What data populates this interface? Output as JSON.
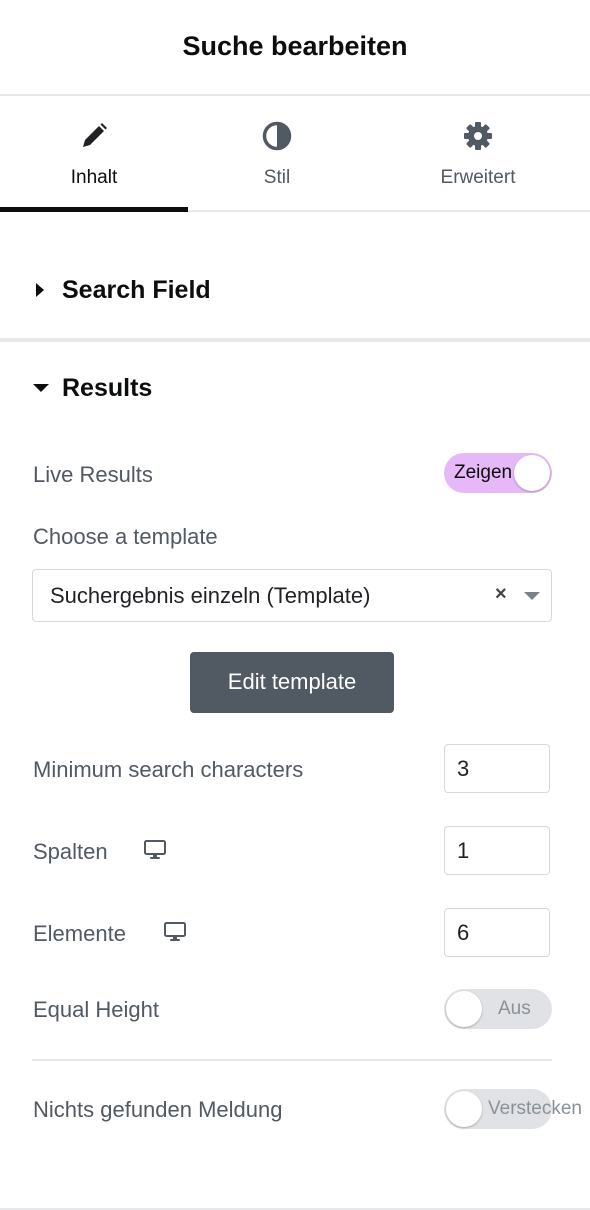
{
  "header": {
    "title": "Suche bearbeiten"
  },
  "tabs": [
    {
      "label": "Inhalt",
      "icon": "pencil-icon",
      "active": true
    },
    {
      "label": "Stil",
      "icon": "contrast-icon",
      "active": false
    },
    {
      "label": "Erweitert",
      "icon": "gear-icon",
      "active": false
    }
  ],
  "sections": {
    "search_field": {
      "title": "Search Field",
      "expanded": false
    },
    "results": {
      "title": "Results",
      "expanded": true
    }
  },
  "results": {
    "live_results": {
      "label": "Live Results",
      "toggle": "Zeigen",
      "on": true
    },
    "template": {
      "label": "Choose a template",
      "selected": "Suchergebnis einzeln (Template)",
      "clear": "×"
    },
    "edit_button": "Edit template",
    "min_chars": {
      "label": "Minimum search characters",
      "value": "3"
    },
    "columns": {
      "label": "Spalten",
      "value": "1",
      "icon": "desktop-icon"
    },
    "elements": {
      "label": "Elemente",
      "value": "6",
      "icon": "desktop-icon"
    },
    "equal_height": {
      "label": "Equal Height",
      "toggle": "Aus",
      "on": false
    },
    "nothing_found": {
      "label": "Nichts gefunden Meldung",
      "toggle": "Verstecken",
      "on": false
    }
  },
  "colors": {
    "accent_toggle": "#e6b8f7",
    "button": "#515962",
    "text": "#515962",
    "heading": "#0c0d0e"
  }
}
